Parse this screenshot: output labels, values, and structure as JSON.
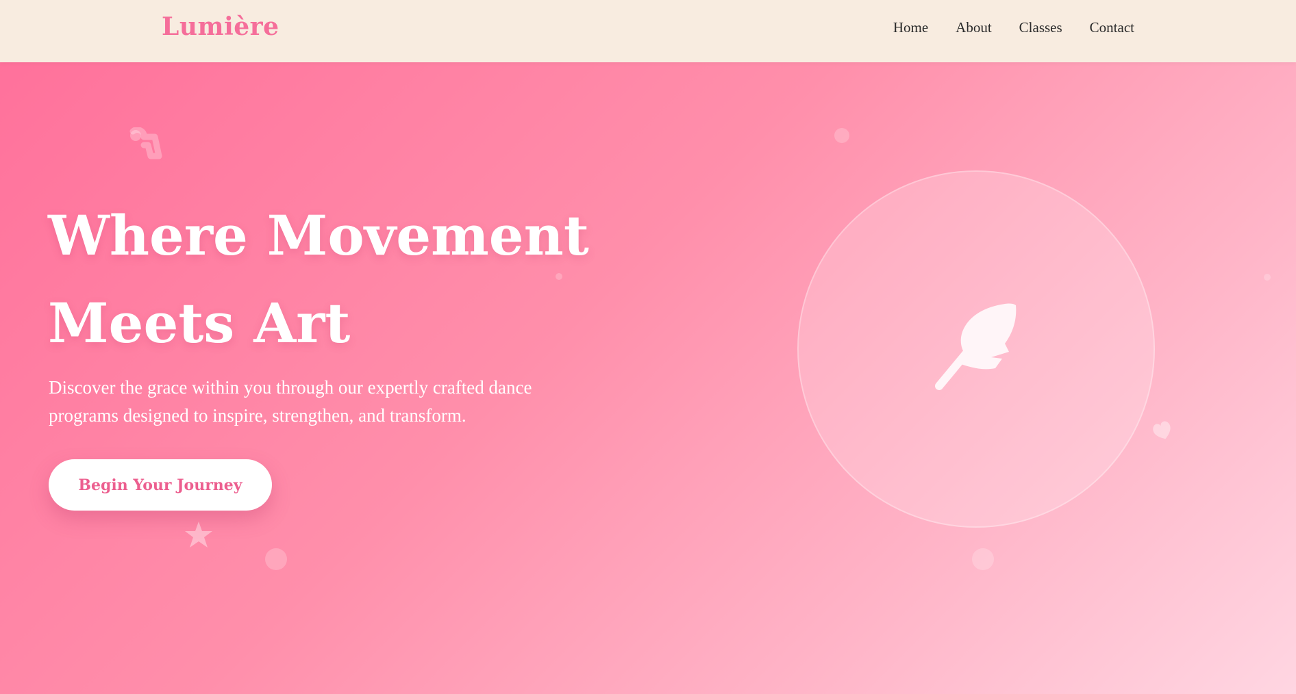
{
  "brand": {
    "logo": "Lumière",
    "accent_color": "#f56e9a",
    "header_bg": "#f8ece0"
  },
  "nav": {
    "items": [
      {
        "label": "Home"
      },
      {
        "label": "About"
      },
      {
        "label": "Classes"
      },
      {
        "label": "Contact"
      }
    ]
  },
  "hero": {
    "title_line1": "Where Movement",
    "title_line2": "Meets Art",
    "subtitle": "Discover the grace within you through our expertly crafted dance programs designed to inspire, strengthen, and transform.",
    "cta_label": "Begin Your Journey"
  },
  "illustration": {
    "icon": "feather-icon"
  },
  "decorations": [
    "music-note-icon",
    "star-icon",
    "heart-icon",
    "sparkle-dot"
  ]
}
